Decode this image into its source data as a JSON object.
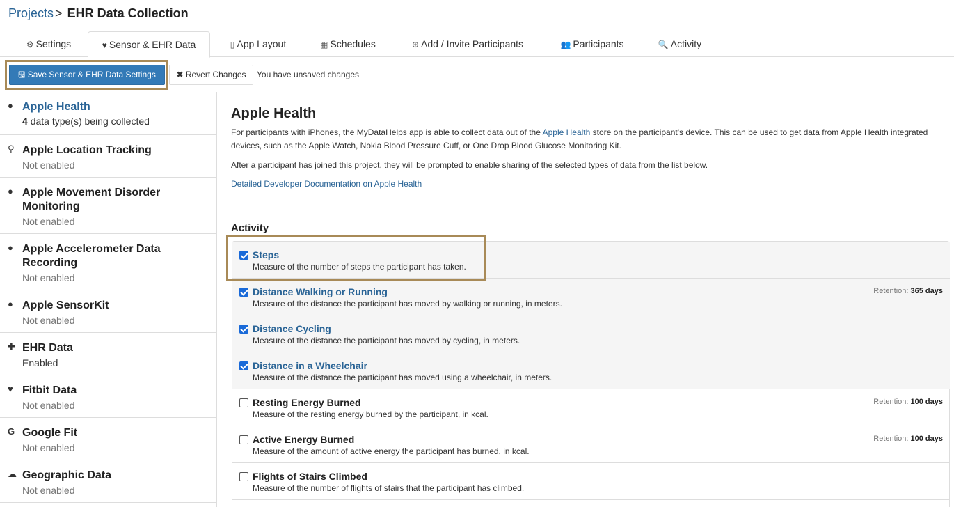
{
  "breadcrumb": {
    "root": "Projects",
    "separator": ">",
    "current": "EHR Data Collection"
  },
  "tabs": [
    {
      "label": "Settings",
      "icon": "gear-icon"
    },
    {
      "label": "Sensor & EHR Data",
      "icon": "heartbeat-icon"
    },
    {
      "label": "App Layout",
      "icon": "mobile-icon"
    },
    {
      "label": "Schedules",
      "icon": "calendar-icon"
    },
    {
      "label": "Add / Invite Participants",
      "icon": "plus-circle-icon"
    },
    {
      "label": "Participants",
      "icon": "users-icon"
    },
    {
      "label": "Activity",
      "icon": "search-icon"
    }
  ],
  "toolbar": {
    "save_label": "Save Sensor & EHR Data Settings",
    "revert_label": "Revert Changes",
    "unsaved_text": "You have unsaved changes"
  },
  "sidebar": {
    "items": [
      {
        "title": "Apple Health",
        "count": "4",
        "sub": "data type(s) being collected",
        "icon": "apple-icon"
      },
      {
        "title": "Apple Location Tracking",
        "sub": "Not enabled",
        "icon": "map-marker-icon"
      },
      {
        "title": "Apple Movement Disorder Monitoring",
        "sub": "Not enabled",
        "icon": "apple-icon"
      },
      {
        "title": "Apple Accelerometer Data Recording",
        "sub": "Not enabled",
        "icon": "apple-icon"
      },
      {
        "title": "Apple SensorKit",
        "sub": "Not enabled",
        "icon": "apple-icon"
      },
      {
        "title": "EHR Data",
        "sub": "Enabled",
        "icon": "medkit-icon"
      },
      {
        "title": "Fitbit Data",
        "sub": "Not enabled",
        "icon": "heartbeat-icon"
      },
      {
        "title": "Google Fit",
        "sub": "Not enabled",
        "icon": "google-icon"
      },
      {
        "title": "Geographic Data",
        "sub": "Not enabled",
        "icon": "cloud-icon"
      }
    ]
  },
  "main": {
    "title": "Apple Health",
    "para1_a": "For participants with iPhones, the MyDataHelps app is able to collect data out of the ",
    "para1_link": "Apple Health",
    "para1_b": " store on the participant's device. This can be used to get data from Apple Health integrated devices, such as the Apple Watch, Nokia Blood Pressure Cuff, or One Drop Blood Glucose Monitoring Kit.",
    "para2": "After a participant has joined this project, they will be prompted to enable sharing of the selected types of data from the list below.",
    "doc_link": "Detailed Developer Documentation on Apple Health",
    "section_title": "Activity",
    "retention_label": "Retention:",
    "data_types": [
      {
        "name": "Steps",
        "desc": "Measure of the number of steps the participant has taken.",
        "checked": true,
        "retention": ""
      },
      {
        "name": "Distance Walking or Running",
        "desc": "Measure of the distance the participant has moved by walking or running, in meters.",
        "checked": true,
        "retention": "365 days"
      },
      {
        "name": "Distance Cycling",
        "desc": "Measure of the distance the participant has moved by cycling, in meters.",
        "checked": true,
        "retention": ""
      },
      {
        "name": "Distance in a Wheelchair",
        "desc": "Measure of the distance the participant has moved using a wheelchair, in meters.",
        "checked": true,
        "retention": ""
      },
      {
        "name": "Resting Energy Burned",
        "desc": "Measure of the resting energy burned by the participant, in kcal.",
        "checked": false,
        "retention": "100 days"
      },
      {
        "name": "Active Energy Burned",
        "desc": "Measure of the amount of active energy the participant has burned, in kcal.",
        "checked": false,
        "retention": "100 days"
      },
      {
        "name": "Flights of Stairs Climbed",
        "desc": "Measure of the number of flights of stairs that the participant has climbed.",
        "checked": false,
        "retention": ""
      }
    ]
  },
  "colors": {
    "link": "#2a6496",
    "primary": "#337ab7",
    "highlight": "#a88a57",
    "checkbox": "#1a6ad8"
  }
}
